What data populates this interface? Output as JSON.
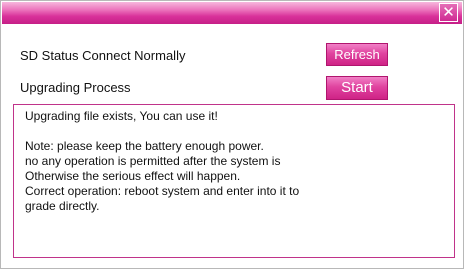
{
  "window": {
    "close_glyph": "✕",
    "close_icon": "close-icon",
    "accent_color": "#d9319a"
  },
  "status": {
    "sd_label": "SD Status Connect Normally",
    "refresh_label": "Refresh"
  },
  "upgrade": {
    "process_label": "Upgrading Process",
    "start_label": "Start"
  },
  "messages": {
    "line1": "Upgrading file exists, You can use it!",
    "line2": "Note: please keep the battery enough power.",
    "line3": "no any operation is permitted after the system is",
    "line4": "Otherwise the serious effect will happen.",
    "line5": "Correct operation: reboot system and enter into it to",
    "line6": "grade directly."
  }
}
